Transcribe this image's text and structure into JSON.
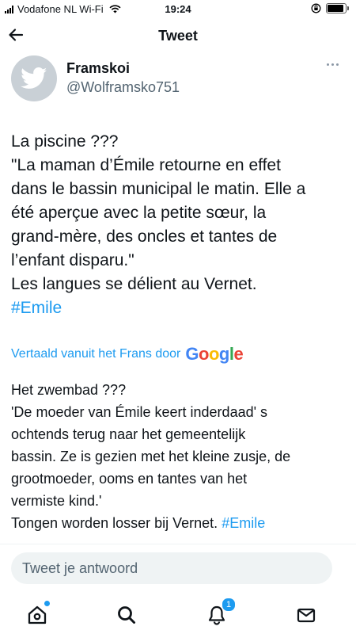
{
  "status_bar": {
    "carrier": "Vodafone NL Wi-Fi",
    "time": "19:24"
  },
  "nav": {
    "title": "Tweet"
  },
  "author": {
    "name": "Framskoi",
    "handle": "@Wolframsko751"
  },
  "tweet": {
    "lines": [
      "La piscine ???",
      "\"La maman d’Émile retourne en effet",
      "dans le bassin municipal le matin. Elle a",
      "été aperçue avec la petite sœur, la",
      "grand-mère, des oncles et tantes de",
      "l’enfant disparu.\"",
      "Les langues se délient au Vernet."
    ],
    "hashtag": "#Emile"
  },
  "translation": {
    "label": "Vertaald vanuit het Frans door",
    "provider": "Google",
    "lines": [
      "Het zwembad ???",
      "'De moeder van Émile keert inderdaad' s",
      "ochtends terug naar het gemeentelijk",
      "bassin. Ze is gezien met het kleine zusje, de",
      "grootmoeder, ooms en tantes van het",
      "vermiste kind.'"
    ],
    "last_line": "Tongen worden losser bij Vernet.",
    "hashtag": "#Emile"
  },
  "reply": {
    "placeholder": "Tweet je antwoord"
  },
  "tab_bar": {
    "notifications_count": "1",
    "icons": [
      "home-icon",
      "search-icon",
      "notifications-icon",
      "messages-icon"
    ]
  },
  "colors": {
    "accent": "#1d9bf0",
    "text": "#0f1419",
    "secondary": "#536471"
  }
}
